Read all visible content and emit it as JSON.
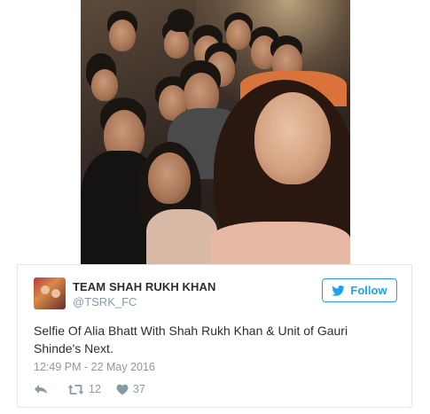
{
  "tweet": {
    "display_name": "TEAM SHAH RUKH KHAN",
    "handle": "@TSRK_FC",
    "follow_label": "Follow",
    "text_line1": "Selfie Of Alia Bhatt With Shah Rukh Khan & Unit of Gauri",
    "text_line2": "Shinde's Next.",
    "timestamp": "12:49 PM - 22 May 2016",
    "retweet_count": "12",
    "like_count": "37"
  },
  "icons": {
    "follow": "twitter-bird-icon",
    "reply": "reply-icon",
    "retweet": "retweet-icon",
    "like": "heart-icon"
  },
  "colors": {
    "accent": "#1da1f2",
    "text": "#292f33",
    "muted": "#8899a6",
    "border": "#e1e8ed"
  }
}
